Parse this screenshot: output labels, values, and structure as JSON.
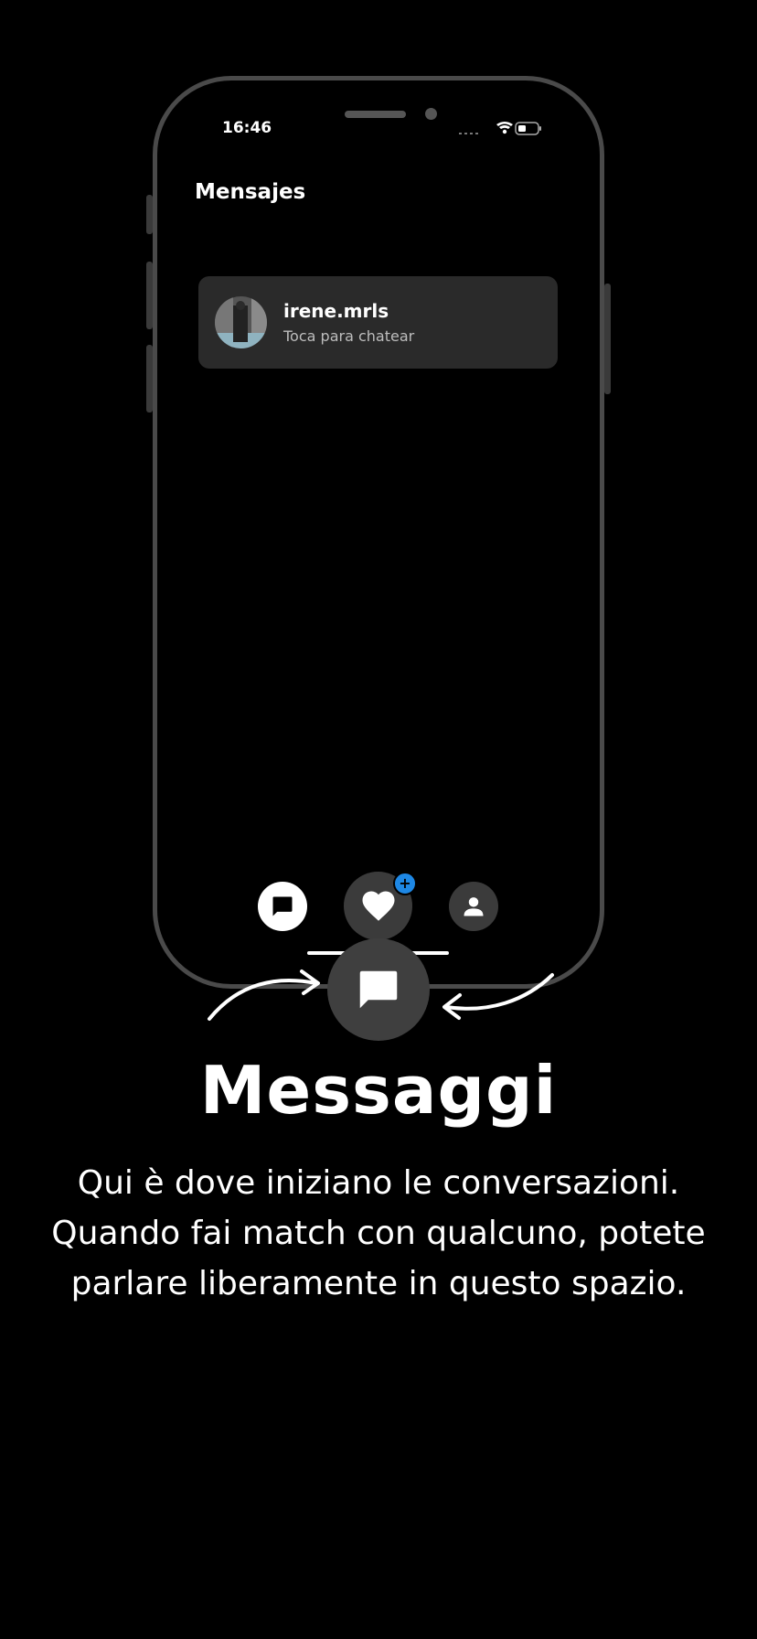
{
  "status": {
    "time": "16:46"
  },
  "screen": {
    "title": "Mensajes"
  },
  "chat": {
    "name": "irene.mrls",
    "subtitle": "Toca para chatear"
  },
  "nav": {
    "badge": "+"
  },
  "feature": {
    "title": "Messaggi",
    "line1": "Qui è dove iniziano le conversazioni.",
    "line2": "Quando fai match con qualcuno, potete",
    "line3": "parlare liberamente in questo spazio."
  },
  "icons": {
    "nav_chat": "chat-bubble-icon",
    "nav_heart": "heart-icon",
    "nav_profile": "person-icon",
    "feature": "chat-bubble-icon"
  },
  "colors": {
    "badge": "#1e88e5",
    "card": "#2a2a2a",
    "nav_inactive": "#3b3b3b"
  }
}
